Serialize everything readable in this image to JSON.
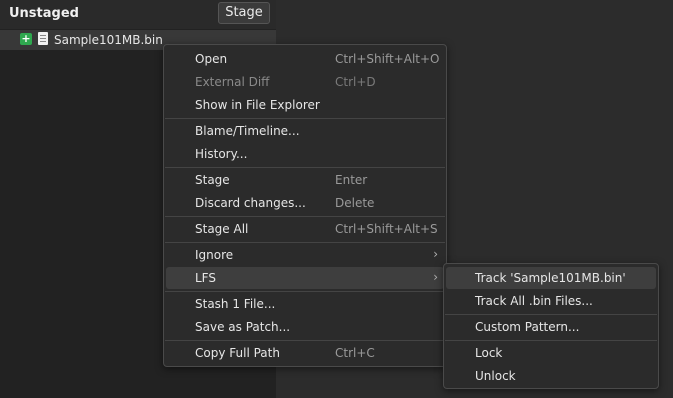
{
  "panel": {
    "title": "Unstaged",
    "stage_button": "Stage"
  },
  "file": {
    "name": "Sample101MB.bin",
    "status_icon": "+"
  },
  "context_menu": {
    "open": {
      "label": "Open",
      "shortcut": "Ctrl+Shift+Alt+O"
    },
    "external_diff": {
      "label": "External Diff",
      "shortcut": "Ctrl+D"
    },
    "show_in_explorer": {
      "label": "Show in File Explorer"
    },
    "blame": {
      "label": "Blame/Timeline..."
    },
    "history": {
      "label": "History..."
    },
    "stage": {
      "label": "Stage",
      "shortcut": "Enter"
    },
    "discard": {
      "label": "Discard changes...",
      "shortcut": "Delete"
    },
    "stage_all": {
      "label": "Stage All",
      "shortcut": "Ctrl+Shift+Alt+S"
    },
    "ignore": {
      "label": "Ignore",
      "arrow": "›"
    },
    "lfs": {
      "label": "LFS",
      "arrow": "›"
    },
    "stash": {
      "label": "Stash 1 File..."
    },
    "save_patch": {
      "label": "Save as Patch..."
    },
    "copy_path": {
      "label": "Copy Full Path",
      "shortcut": "Ctrl+C"
    }
  },
  "lfs_submenu": {
    "track_file": "Track 'Sample101MB.bin'",
    "track_ext": "Track All .bin Files...",
    "custom": "Custom Pattern...",
    "lock": "Lock",
    "unlock": "Unlock"
  },
  "colors": {
    "added_badge": "#2fa84f",
    "menu_bg": "#2b2b2b",
    "highlight": "#3e3e3e"
  }
}
